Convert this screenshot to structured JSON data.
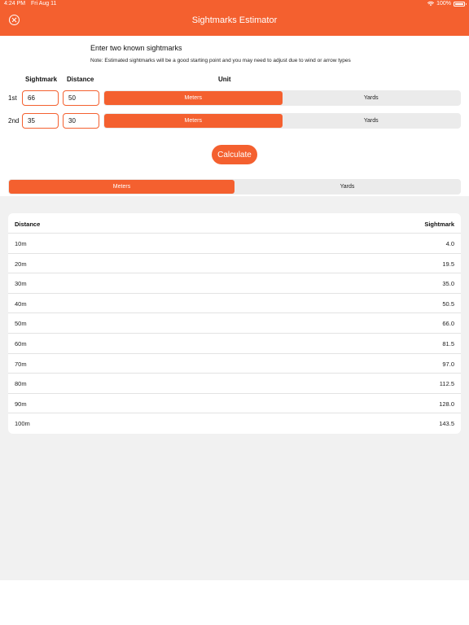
{
  "status_bar": {
    "time": "4:24 PM",
    "date": "Fri Aug 11",
    "battery": "100%"
  },
  "header": {
    "title": "Sightmarks Estimator"
  },
  "intro_text": "Enter two known sightmarks",
  "note_text": "Note: Estimated sightmarks will be a good starting point and you may need to adjust due to wind or arrow types",
  "columns": {
    "sightmark": "Sightmark",
    "distance": "Distance",
    "unit": "Unit"
  },
  "inputs": [
    {
      "label": "1st",
      "sightmark": "66",
      "distance": "50",
      "unit_selected": "Meters"
    },
    {
      "label": "2nd",
      "sightmark": "35",
      "distance": "30",
      "unit_selected": "Meters"
    }
  ],
  "unit_options": [
    "Meters",
    "Yards"
  ],
  "calculate_label": "Calculate",
  "output_unit": {
    "options": [
      "Meters",
      "Yards"
    ],
    "selected": "Meters"
  },
  "table": {
    "headers": {
      "distance": "Distance",
      "sightmark": "Sightmark"
    },
    "rows": [
      {
        "distance": "10m",
        "sightmark": "4.0"
      },
      {
        "distance": "20m",
        "sightmark": "19.5"
      },
      {
        "distance": "30m",
        "sightmark": "35.0"
      },
      {
        "distance": "40m",
        "sightmark": "50.5"
      },
      {
        "distance": "50m",
        "sightmark": "66.0"
      },
      {
        "distance": "60m",
        "sightmark": "81.5"
      },
      {
        "distance": "70m",
        "sightmark": "97.0"
      },
      {
        "distance": "80m",
        "sightmark": "112.5"
      },
      {
        "distance": "90m",
        "sightmark": "128.0"
      },
      {
        "distance": "100m",
        "sightmark": "143.5"
      }
    ]
  },
  "colors": {
    "accent": "#f4602f",
    "segment_bg": "#ebebeb",
    "background_gray": "#f1f1f1"
  },
  "icons": {
    "close": "close-circle-icon",
    "wifi": "wifi-icon",
    "battery": "battery-icon"
  }
}
